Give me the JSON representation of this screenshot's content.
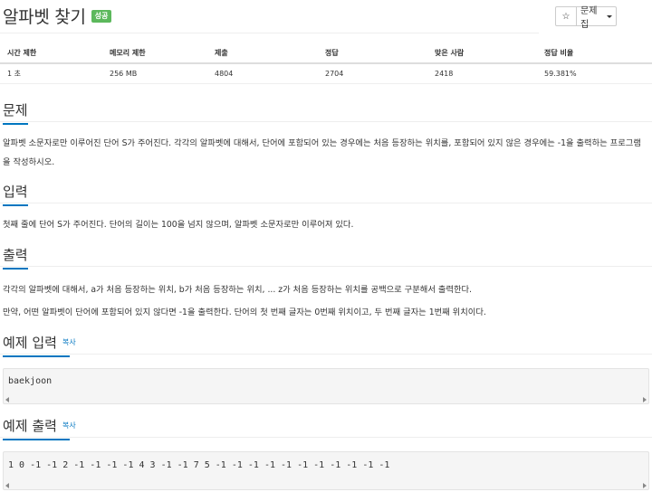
{
  "problem": {
    "title": "알파벳 찾기",
    "badge": "성공"
  },
  "toolbar": {
    "star_icon": "☆",
    "set_label": "문제집"
  },
  "stats": {
    "headers": [
      "시간 제한",
      "메모리 제한",
      "제출",
      "정답",
      "맞은 사람",
      "정답 비율"
    ],
    "values": [
      "1 초",
      "256 MB",
      "4804",
      "2704",
      "2418",
      "59.381%"
    ]
  },
  "sections": {
    "problem": {
      "title": "문제",
      "text": "알파벳 소문자로만 이루어진 단어 S가 주어진다. 각각의 알파벳에 대해서, 단어에 포함되어 있는 경우에는 처음 등장하는 위치를, 포함되어 있지 않은 경우에는 -1을 출력하는 프로그램을 작성하시오."
    },
    "input": {
      "title": "입력",
      "text": "첫째 줄에 단어 S가 주어진다. 단어의 길이는 100을 넘지 않으며, 알파벳 소문자로만 이루어져 있다."
    },
    "output": {
      "title": "출력",
      "text1": "각각의 알파벳에 대해서, a가 처음 등장하는 위치, b가 처음 등장하는 위치, ... z가 처음 등장하는 위치를 공백으로 구분해서 출력한다.",
      "text2": "만약, 어떤 알파벳이 단어에 포함되어 있지 않다면 -1을 출력한다. 단어의 첫 번째 글자는 0번째 위치이고, 두 번째 글자는 1번째 위치이다."
    },
    "sample_input": {
      "title": "예제 입력",
      "copy": "복사",
      "content": "baekjoon"
    },
    "sample_output": {
      "title": "예제 출력",
      "copy": "복사",
      "content": "1 0 -1 -1 2 -1 -1 -1 -1 4 3 -1 -1 7 5 -1 -1 -1 -1 -1 -1 -1 -1 -1 -1 -1"
    }
  },
  "colors": {
    "accent": "#0076c0",
    "badge": "#5cb85c"
  }
}
